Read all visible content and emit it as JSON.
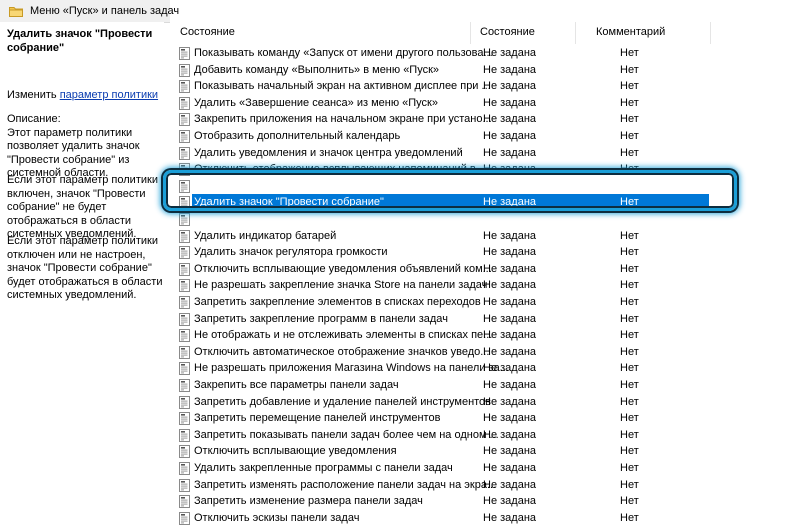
{
  "breadcrumb": {
    "text": "Меню «Пуск» и панель задач"
  },
  "description": {
    "title": "Удалить значок \"Провести собрание\"",
    "edit_prefix": "Изменить ",
    "edit_link": "параметр политики",
    "paragraphs": [
      "Описание:\nЭтот параметр политики позволяет удалить значок \"Провести собрание\" из системной области.",
      "Если этот параметр политики включен, значок \"Провести собрание\" не будет отображаться в области системных уведомлений.",
      "Если этот параметр политики отключен или не настроен, значок \"Провести собрание\" будет отображаться в области системных уведомлений."
    ]
  },
  "columns": {
    "name": "Состояние",
    "state": "Состояние",
    "comment": "Комментарий"
  },
  "rows": [
    {
      "name": "Показывать команду «Запуск от имени другого пользова...",
      "state": "Не задана",
      "comment": "Нет"
    },
    {
      "name": "Добавить команду «Выполнить» в меню «Пуск»",
      "state": "Не задана",
      "comment": "Нет"
    },
    {
      "name": "Показывать начальный экран на активном дисплее при ...",
      "state": "Не задана",
      "comment": "Нет"
    },
    {
      "name": "Удалить «Завершение сеанса» из меню «Пуск»",
      "state": "Не задана",
      "comment": "Нет"
    },
    {
      "name": "Закрепить приложения на начальном экране при устано...",
      "state": "Не задана",
      "comment": "Нет"
    },
    {
      "name": "Отобразить дополнительный календарь",
      "state": "Не задана",
      "comment": "Нет"
    },
    {
      "name": "Удалить уведомления и значок центра уведомлений",
      "state": "Не задана",
      "comment": "Нет"
    },
    {
      "name": "Отключить отображение всплывающих напоминаний в ...",
      "state": "Не задана",
      "comment": "Нет"
    },
    {
      "name": "",
      "state": "",
      "comment": "",
      "partial": true
    },
    {
      "name": "Удалить значок \"Провести собрание\"",
      "state": "Не задана",
      "comment": "Нет",
      "selected": true
    },
    {
      "name": "",
      "state": "",
      "comment": "",
      "partial": true
    },
    {
      "name": "Удалить индикатор батарей",
      "state": "Не задана",
      "comment": "Нет"
    },
    {
      "name": "Удалить значок регулятора громкости",
      "state": "Не задана",
      "comment": "Нет"
    },
    {
      "name": "Отключить всплывающие уведомления объявлений ком...",
      "state": "Не задана",
      "comment": "Нет"
    },
    {
      "name": "Не разрешать закрепление значка Store на панели задач",
      "state": "Не задана",
      "comment": "Нет"
    },
    {
      "name": "Запретить закрепление элементов в списках переходов",
      "state": "Не задана",
      "comment": "Нет"
    },
    {
      "name": "Запретить закрепление программ в панели задач",
      "state": "Не задана",
      "comment": "Нет"
    },
    {
      "name": "Не отображать и не отслеживать элементы в списках пе...",
      "state": "Не задана",
      "comment": "Нет"
    },
    {
      "name": "Отключить автоматическое отображение значков уведо...",
      "state": "Не задана",
      "comment": "Нет"
    },
    {
      "name": "Не разрешать приложения Магазина Windows на панели за...",
      "state": "Не задана",
      "comment": "Нет"
    },
    {
      "name": "Закрепить все параметры панели задач",
      "state": "Не задана",
      "comment": "Нет"
    },
    {
      "name": "Запретить добавление и удаление панелей инструментов",
      "state": "Не задана",
      "comment": "Нет"
    },
    {
      "name": "Запретить перемещение панелей инструментов",
      "state": "Не задана",
      "comment": "Нет"
    },
    {
      "name": "Запретить показывать панели задач более чем на одном ...",
      "state": "Не задана",
      "comment": "Нет"
    },
    {
      "name": "Отключить всплывающие уведомления",
      "state": "Не задана",
      "comment": "Нет"
    },
    {
      "name": "Удалить закрепленные программы с панели задач",
      "state": "Не задана",
      "comment": "Нет"
    },
    {
      "name": "Запретить изменять расположение панели задач на экра...",
      "state": "Не задана",
      "comment": "Нет"
    },
    {
      "name": "Запретить изменение размера панели задач",
      "state": "Не задана",
      "comment": "Нет"
    },
    {
      "name": "Отключить эскизы панели задач",
      "state": "Не задана",
      "comment": "Нет"
    }
  ],
  "colors": {
    "selection": "#0078d7",
    "callout": "#1b9fd8",
    "link": "#0a3cb0"
  },
  "icons": {
    "folder": "folder-icon",
    "policy": "policy-setting-icon"
  }
}
